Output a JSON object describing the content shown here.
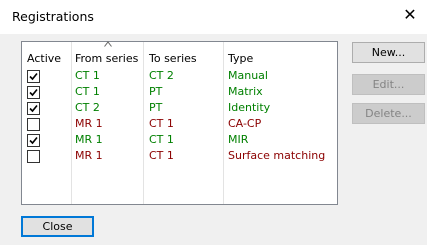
{
  "window": {
    "title": "Registrations",
    "close_glyph": "✕"
  },
  "table": {
    "headers": {
      "active": "Active",
      "from": "From series",
      "to": "To series",
      "type": "Type"
    },
    "rows": [
      {
        "active": true,
        "from": "CT 1",
        "to": "CT 2",
        "type": "Manual",
        "color": "#008000"
      },
      {
        "active": true,
        "from": "CT 1",
        "to": "PT",
        "type": "Matrix",
        "color": "#008000"
      },
      {
        "active": true,
        "from": "CT 2",
        "to": "PT",
        "type": "Identity",
        "color": "#008000"
      },
      {
        "active": false,
        "from": "MR 1",
        "to": "CT 1",
        "type": "CA-CP",
        "color": "#8b0000"
      },
      {
        "active": true,
        "from": "MR 1",
        "to": "CT 1",
        "type": "MIR",
        "color": "#008000"
      },
      {
        "active": false,
        "from": "MR 1",
        "to": "CT 1",
        "type": "Surface matching",
        "color": "#8b0000"
      }
    ]
  },
  "buttons": {
    "new": "New...",
    "edit": "Edit...",
    "delete": "Delete...",
    "close": "Close"
  },
  "colors": {
    "active_row": "#008000",
    "inactive_row": "#8b0000",
    "focus": "#0078d7"
  },
  "icons": {
    "sort": "sort-ascending-icon",
    "check": "checkmark-icon"
  }
}
